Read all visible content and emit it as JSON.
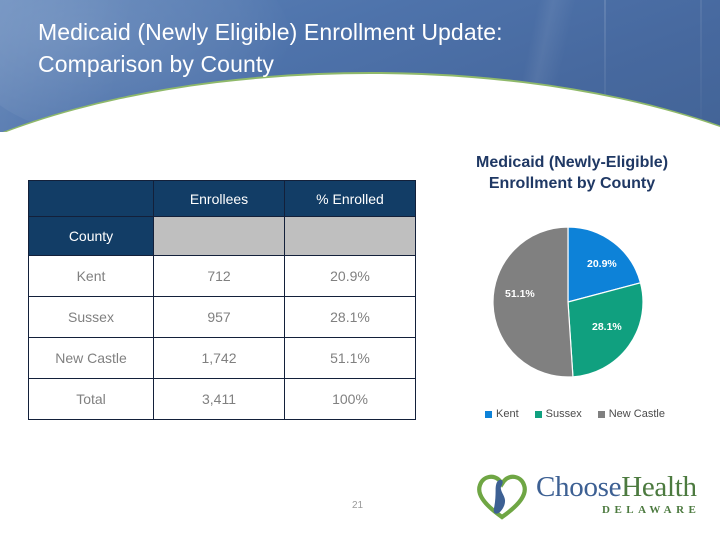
{
  "slide": {
    "title": "Medicaid (Newly Eligible) Enrollment Update:\nComparison by County",
    "page_number": "21",
    "colors": {
      "banner_blue": "#4e73ab",
      "banner_accent_green": "#8fb96a",
      "table_header_navy": "#123d66",
      "table_gray_row": "#bfbfbf",
      "table_text_gray": "#808080",
      "chart_title_navy": "#1f3864"
    }
  },
  "table": {
    "corner_label": "County",
    "columns": [
      "",
      "Enrollees",
      "% Enrolled"
    ],
    "rows": [
      {
        "label": "Kent",
        "enrollees": "712",
        "percent": "20.9%"
      },
      {
        "label": "Sussex",
        "enrollees": "957",
        "percent": "28.1%"
      },
      {
        "label": "New Castle",
        "enrollees": "1,742",
        "percent": "51.1%"
      }
    ],
    "total": {
      "label": "Total",
      "enrollees": "3,411",
      "percent": "100%"
    }
  },
  "chart_data": {
    "type": "pie",
    "title": "Medicaid (Newly-Eligible)\nEnrollment by County",
    "categories": [
      "Kent",
      "Sussex",
      "New Castle"
    ],
    "values": [
      20.9,
      28.1,
      51.1
    ],
    "counts": [
      712,
      957,
      1742
    ],
    "data_labels": [
      "20.9%",
      "28.1%",
      "51.1%"
    ],
    "colors": [
      "#0d82d8",
      "#10a07f",
      "#808080"
    ],
    "legend": {
      "position": "bottom",
      "entries": [
        "Kent",
        "Sussex",
        "New Castle"
      ]
    },
    "start_angle_deg": 0,
    "direction": "clockwise",
    "total": 3411,
    "units": "percent of enrollees",
    "grid": false
  },
  "logo": {
    "name_part1": "Choose",
    "name_part2": "Health",
    "subtitle": "DELAWARE"
  }
}
